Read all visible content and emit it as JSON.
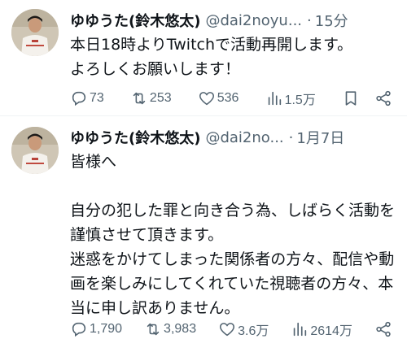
{
  "tweets": [
    {
      "author_name": "ゆゆうた(鈴木悠太)",
      "handle": "@dai2noyu...",
      "separator": "·",
      "time": "15分",
      "text": "本日18時よりTwitchで活動再開します。\nよろしくお願いします！",
      "replies": "73",
      "retweets": "253",
      "likes": "536",
      "views": "1.5万"
    },
    {
      "author_name": "ゆゆうた(鈴木悠太)",
      "handle": "@dai2no...",
      "separator": "·",
      "time": "1月7日",
      "text": "皆様へ\n\n自分の犯した罪と向き合う為、しばらく活動を謹慎させて頂きます。\n迷惑をかけてしまった関係者の方々、配信や動画を楽しみにしてくれていた視聴者の方々、本当に申し訳ありません。",
      "replies": "1,790",
      "retweets": "3,983",
      "likes": "3.6万",
      "views": "2614万"
    }
  ],
  "icons": {
    "reply": "reply-icon",
    "retweet": "retweet-icon",
    "like": "heart-icon",
    "views": "views-icon",
    "bookmark": "bookmark-icon",
    "share": "share-icon"
  },
  "colors": {
    "text": "#0f1419",
    "secondary": "#536471",
    "divider": "#eff3f4"
  }
}
